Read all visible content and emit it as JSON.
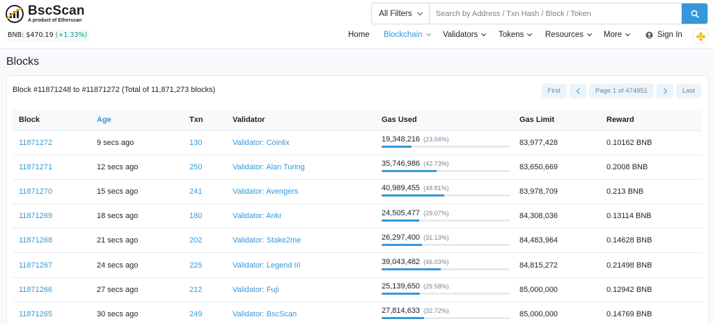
{
  "header": {
    "logo_name": "BscScan",
    "logo_sub": "A product of Etherscan",
    "price_label": "BNB: $470.19",
    "price_change": "(+1.33%)",
    "filter_label": "All Filters",
    "search_placeholder": "Search by Address / Txn Hash / Block / Token",
    "icons": {
      "search": "search-icon",
      "bnb": "bnb-logo-icon",
      "user": "user-circle-icon"
    },
    "nav": [
      {
        "label": "Home",
        "caret": false
      },
      {
        "label": "Blockchain",
        "caret": true,
        "active": true
      },
      {
        "label": "Validators",
        "caret": true
      },
      {
        "label": "Tokens",
        "caret": true
      },
      {
        "label": "Resources",
        "caret": true
      },
      {
        "label": "More",
        "caret": true
      },
      {
        "label": "Sign In",
        "caret": false
      }
    ]
  },
  "page": {
    "title": "Blocks",
    "summary": "Block #11871248 to #11871272 (Total of 11,871,273 blocks)",
    "pager": {
      "first": "First",
      "page": "Page 1 of 474851",
      "last": "Last"
    }
  },
  "table": {
    "columns": [
      "Block",
      "Age",
      "Txn",
      "Validator",
      "Gas Used",
      "Gas Limit",
      "Reward"
    ],
    "rows": [
      {
        "block": "11871272",
        "age": "9 secs ago",
        "txn": "130",
        "validator": "Validator: Coinlix",
        "gas_used": "19,348,216",
        "gas_pct": "(23.04%)",
        "gas_frac": 0.2304,
        "gas_limit": "83,977,428",
        "reward": "0.10162 BNB"
      },
      {
        "block": "11871271",
        "age": "12 secs ago",
        "txn": "250",
        "validator": "Validator: Alan Turing",
        "gas_used": "35,746,986",
        "gas_pct": "(42.73%)",
        "gas_frac": 0.4273,
        "gas_limit": "83,650,669",
        "reward": "0.2008 BNB"
      },
      {
        "block": "11871270",
        "age": "15 secs ago",
        "txn": "241",
        "validator": "Validator: Avengers",
        "gas_used": "40,989,455",
        "gas_pct": "(48.81%)",
        "gas_frac": 0.4881,
        "gas_limit": "83,978,709",
        "reward": "0.213 BNB"
      },
      {
        "block": "11871269",
        "age": "18 secs ago",
        "txn": "180",
        "validator": "Validator: Ankr",
        "gas_used": "24,505,477",
        "gas_pct": "(29.07%)",
        "gas_frac": 0.2907,
        "gas_limit": "84,308,036",
        "reward": "0.13114 BNB"
      },
      {
        "block": "11871268",
        "age": "21 secs ago",
        "txn": "202",
        "validator": "Validator: Stake2me",
        "gas_used": "26,297,400",
        "gas_pct": "(31.13%)",
        "gas_frac": 0.3113,
        "gas_limit": "84,483,964",
        "reward": "0.14628 BNB"
      },
      {
        "block": "11871267",
        "age": "24 secs ago",
        "txn": "225",
        "validator": "Validator: Legend III",
        "gas_used": "39,043,482",
        "gas_pct": "(46.03%)",
        "gas_frac": 0.4603,
        "gas_limit": "84,815,272",
        "reward": "0.21498 BNB"
      },
      {
        "block": "11871266",
        "age": "27 secs ago",
        "txn": "212",
        "validator": "Validator: Fuji",
        "gas_used": "25,139,650",
        "gas_pct": "(29.58%)",
        "gas_frac": 0.2958,
        "gas_limit": "85,000,000",
        "reward": "0.12942 BNB"
      },
      {
        "block": "11871265",
        "age": "30 secs ago",
        "txn": "249",
        "validator": "Validator: BscScan",
        "gas_used": "27,814,633",
        "gas_pct": "(32.72%)",
        "gas_frac": 0.3272,
        "gas_limit": "85,000,000",
        "reward": "0.14769 BNB"
      }
    ]
  },
  "colors": {
    "accent": "#3498db",
    "positive": "#00a186",
    "bnb": "#f0b90b"
  }
}
